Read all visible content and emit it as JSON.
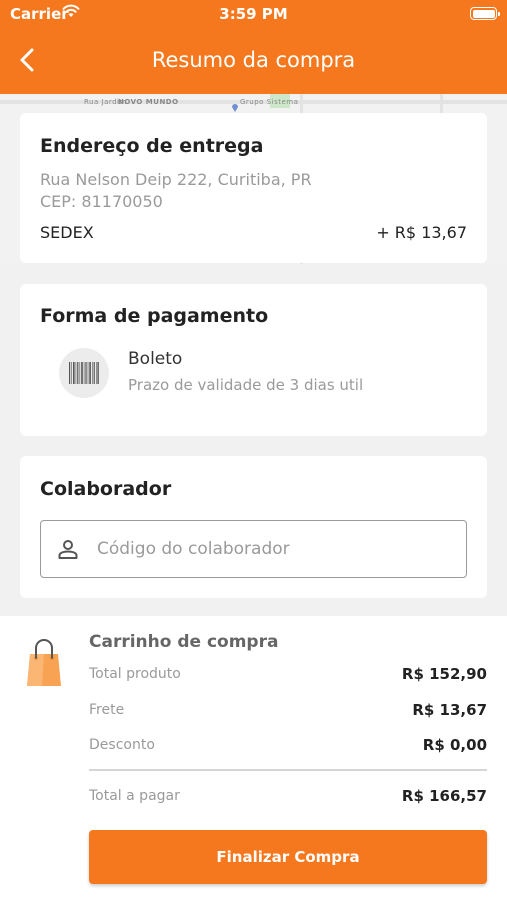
{
  "status_bar": {
    "carrier": "Carrier",
    "time": "3:59 PM"
  },
  "nav": {
    "title": "Resumo da compra"
  },
  "map": {
    "labels": [
      "Rua Jardim",
      "NOVO MUNDO",
      "Grupo Sistema"
    ]
  },
  "address": {
    "title": "Endereço de entrega",
    "street": "Rua Nelson Deip 222, Curitiba, PR",
    "cep": "CEP: 81170050",
    "shipping_method": "SEDEX",
    "shipping_price": "+ R$  13,67"
  },
  "payment": {
    "title": "Forma de pagamento",
    "method": "Boleto",
    "description": "Prazo de validade de 3 dias util"
  },
  "collaborator": {
    "title": "Colaborador",
    "placeholder": "Código do colaborador",
    "value": ""
  },
  "cart": {
    "title": "Carrinho de compra",
    "rows": [
      {
        "label": "Total produto",
        "value": "R$ 152,90"
      },
      {
        "label": "Frete",
        "value": "R$ 13,67"
      },
      {
        "label": "Desconto",
        "value": "R$ 0,00"
      }
    ],
    "total_label": "Total a pagar",
    "total_value": "R$ 166,57",
    "finalize_label": "Finalizar Compra"
  },
  "colors": {
    "accent": "#f6781e",
    "bag": "#f8a253"
  }
}
